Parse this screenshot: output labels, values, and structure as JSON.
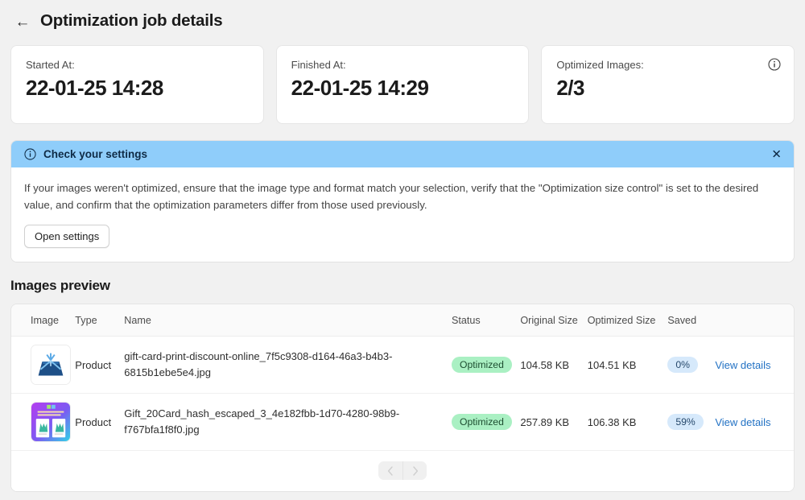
{
  "header": {
    "back_icon": "arrow-left-icon",
    "title": "Optimization job details"
  },
  "stats": [
    {
      "label": "Started At:",
      "value": "22-01-25 14:28",
      "info": false
    },
    {
      "label": "Finished At:",
      "value": "22-01-25 14:29",
      "info": false
    },
    {
      "label": "Optimized Images:",
      "value": "2/3",
      "info": true,
      "info_icon": "info-circle-icon"
    }
  ],
  "banner": {
    "icon": "info-circle-icon",
    "title": "Check your settings",
    "close_icon": "close-icon",
    "body": "If your images weren't optimized, ensure that the image type and format match your selection, verify that the \"Optimization size control\" is set to the desired value, and confirm that the optimization parameters differ from those used previously.",
    "button_label": "Open settings",
    "accent_color": "#8fcdfa"
  },
  "section": {
    "title": "Images preview"
  },
  "table": {
    "columns": [
      "Image",
      "Type",
      "Name",
      "Status",
      "Original Size",
      "Optimized Size",
      "Saved",
      ""
    ],
    "rows": [
      {
        "thumbnail": "product-thumbnail-blue-giftcard",
        "type": "Product",
        "name": "gift-card-print-discount-online_7f5c9308-d164-46a3-b4b3-6815b1ebe5e4.jpg",
        "status": "Optimized",
        "original_size": "104.58 KB",
        "optimized_size": "104.51 KB",
        "saved": "0%",
        "action": "View details"
      },
      {
        "thumbnail": "product-thumbnail-gradient-giftcard",
        "type": "Product",
        "name": "Gift_20Card_hash_escaped_3_4e182fbb-1d70-4280-98b9-f767bfa1f8f0.jpg",
        "status": "Optimized",
        "original_size": "257.89 KB",
        "optimized_size": "106.38 KB",
        "saved": "59%",
        "action": "View details"
      }
    ]
  },
  "pagination": {
    "prev_icon": "chevron-left-icon",
    "next_icon": "chevron-right-icon"
  },
  "colors": {
    "page_background": "#f1f1f1",
    "banner_header": "#8fcdfa",
    "status_badge_bg": "#aaf0c3",
    "saved_badge_bg": "#d6e9fb",
    "link": "#2372c4"
  }
}
